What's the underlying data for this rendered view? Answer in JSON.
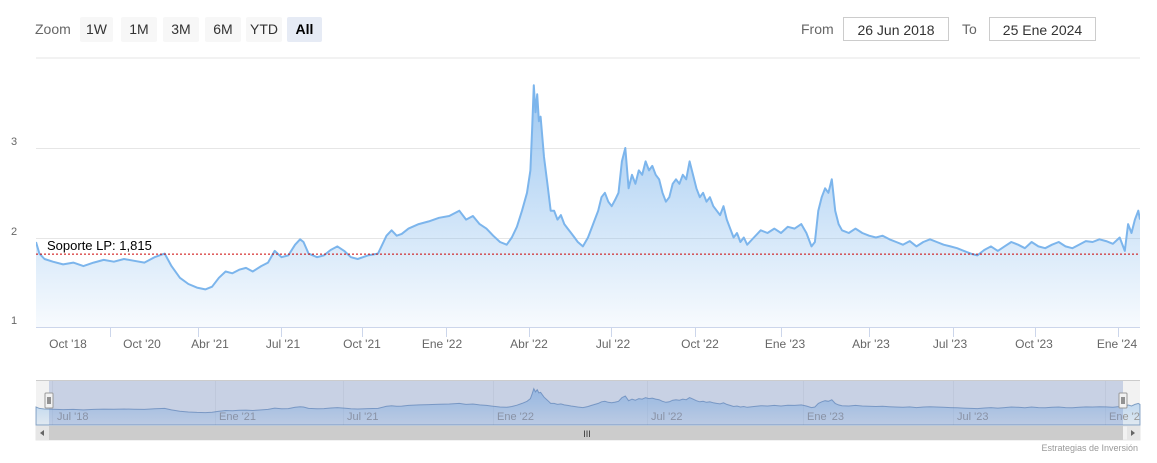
{
  "toolbar": {
    "zoom_label": "Zoom",
    "buttons": [
      "1W",
      "1M",
      "3M",
      "6M",
      "YTD",
      "All"
    ],
    "active": "All",
    "from_label": "From",
    "from_value": "26 Jun 2018",
    "to_label": "To",
    "to_value": "25 Ene 2024"
  },
  "credit": "Estrategias de Inversión",
  "navigator_labels": [
    "Jul '18",
    "Ene '21",
    "Jul '21",
    "Ene '22",
    "Jul '22",
    "Ene '23",
    "Jul '23",
    "Ene '2"
  ],
  "scrollbar_grip": "III",
  "colors": {
    "line": "#7cb5ec",
    "support": "#cc0000",
    "grid": "#e6e6e6"
  },
  "chart_data": {
    "type": "area",
    "title": "",
    "xlabel": "",
    "ylabel": "",
    "ylim": [
      1,
      3.9
    ],
    "y_ticks": [
      1,
      2,
      3
    ],
    "x_ticks": [
      "Oct '18",
      "Oct '20",
      "Abr '21",
      "Jul '21",
      "Oct '21",
      "Ene '22",
      "Abr '22",
      "Jul '22",
      "Oct '22",
      "Ene '23",
      "Abr '23",
      "Jul '23",
      "Oct '23",
      "Ene '24"
    ],
    "grid": true,
    "support_line": {
      "label": "Soporte LP: 1,815",
      "value": 1.815
    },
    "series": [
      {
        "values": [
          [
            0,
            1.95
          ],
          [
            2,
            1.82
          ],
          [
            5,
            1.76
          ],
          [
            10,
            1.73
          ],
          [
            16,
            1.7
          ],
          [
            22,
            1.72
          ],
          [
            28,
            1.68
          ],
          [
            34,
            1.72
          ],
          [
            40,
            1.75
          ],
          [
            46,
            1.73
          ],
          [
            52,
            1.76
          ],
          [
            58,
            1.74
          ],
          [
            64,
            1.72
          ],
          [
            70,
            1.78
          ],
          [
            76,
            1.82
          ],
          [
            80,
            1.68
          ],
          [
            85,
            1.55
          ],
          [
            90,
            1.48
          ],
          [
            95,
            1.44
          ],
          [
            100,
            1.42
          ],
          [
            104,
            1.45
          ],
          [
            108,
            1.55
          ],
          [
            112,
            1.62
          ],
          [
            116,
            1.6
          ],
          [
            120,
            1.64
          ],
          [
            124,
            1.66
          ],
          [
            128,
            1.62
          ],
          [
            133,
            1.68
          ],
          [
            137,
            1.72
          ],
          [
            141,
            1.85
          ],
          [
            145,
            1.78
          ],
          [
            149,
            1.8
          ],
          [
            153,
            1.92
          ],
          [
            156,
            1.98
          ],
          [
            158,
            1.95
          ],
          [
            161,
            1.82
          ],
          [
            166,
            1.78
          ],
          [
            170,
            1.8
          ],
          [
            174,
            1.86
          ],
          [
            178,
            1.9
          ],
          [
            182,
            1.85
          ],
          [
            186,
            1.78
          ],
          [
            190,
            1.76
          ],
          [
            196,
            1.8
          ],
          [
            202,
            1.82
          ],
          [
            207,
            2.02
          ],
          [
            210,
            2.08
          ],
          [
            213,
            2.02
          ],
          [
            216,
            2.04
          ],
          [
            220,
            2.1
          ],
          [
            226,
            2.15
          ],
          [
            232,
            2.18
          ],
          [
            238,
            2.22
          ],
          [
            244,
            2.24
          ],
          [
            250,
            2.3
          ],
          [
            254,
            2.2
          ],
          [
            258,
            2.24
          ],
          [
            262,
            2.15
          ],
          [
            266,
            2.1
          ],
          [
            270,
            2.02
          ],
          [
            274,
            1.95
          ],
          [
            278,
            1.92
          ],
          [
            281,
            2.0
          ],
          [
            284,
            2.12
          ],
          [
            287,
            2.3
          ],
          [
            290,
            2.5
          ],
          [
            292,
            2.75
          ],
          [
            293,
            3.2
          ],
          [
            294,
            3.7
          ],
          [
            295,
            3.4
          ],
          [
            296,
            3.6
          ],
          [
            297,
            3.3
          ],
          [
            298,
            3.35
          ],
          [
            300,
            2.9
          ],
          [
            302,
            2.6
          ],
          [
            304,
            2.3
          ],
          [
            306,
            2.3
          ],
          [
            308,
            2.2
          ],
          [
            310,
            2.25
          ],
          [
            312,
            2.15
          ],
          [
            314,
            2.1
          ],
          [
            316,
            2.05
          ],
          [
            318,
            2.0
          ],
          [
            320,
            1.95
          ],
          [
            323,
            1.9
          ],
          [
            326,
            2.0
          ],
          [
            328,
            2.1
          ],
          [
            330,
            2.2
          ],
          [
            332,
            2.3
          ],
          [
            334,
            2.45
          ],
          [
            336,
            2.5
          ],
          [
            338,
            2.4
          ],
          [
            340,
            2.35
          ],
          [
            342,
            2.42
          ],
          [
            344,
            2.5
          ],
          [
            346,
            2.85
          ],
          [
            348,
            3.0
          ],
          [
            350,
            2.55
          ],
          [
            352,
            2.7
          ],
          [
            354,
            2.6
          ],
          [
            356,
            2.75
          ],
          [
            358,
            2.7
          ],
          [
            360,
            2.85
          ],
          [
            362,
            2.75
          ],
          [
            364,
            2.8
          ],
          [
            366,
            2.7
          ],
          [
            368,
            2.65
          ],
          [
            370,
            2.5
          ],
          [
            372,
            2.4
          ],
          [
            374,
            2.45
          ],
          [
            376,
            2.6
          ],
          [
            378,
            2.65
          ],
          [
            380,
            2.6
          ],
          [
            382,
            2.7
          ],
          [
            384,
            2.65
          ],
          [
            386,
            2.85
          ],
          [
            388,
            2.7
          ],
          [
            390,
            2.55
          ],
          [
            392,
            2.45
          ],
          [
            394,
            2.5
          ],
          [
            396,
            2.4
          ],
          [
            398,
            2.45
          ],
          [
            400,
            2.35
          ],
          [
            402,
            2.3
          ],
          [
            404,
            2.25
          ],
          [
            406,
            2.35
          ],
          [
            408,
            2.2
          ],
          [
            410,
            2.1
          ],
          [
            412,
            2.0
          ],
          [
            414,
            2.05
          ],
          [
            416,
            1.95
          ],
          [
            418,
            2.0
          ],
          [
            420,
            1.92
          ],
          [
            424,
            2.0
          ],
          [
            428,
            2.08
          ],
          [
            432,
            2.05
          ],
          [
            436,
            2.1
          ],
          [
            440,
            2.05
          ],
          [
            444,
            2.12
          ],
          [
            448,
            2.1
          ],
          [
            452,
            2.15
          ],
          [
            455,
            2.05
          ],
          [
            458,
            1.9
          ],
          [
            460,
            1.95
          ],
          [
            462,
            2.3
          ],
          [
            464,
            2.45
          ],
          [
            466,
            2.55
          ],
          [
            468,
            2.5
          ],
          [
            470,
            2.65
          ],
          [
            472,
            2.3
          ],
          [
            474,
            2.15
          ],
          [
            476,
            2.08
          ],
          [
            480,
            2.05
          ],
          [
            484,
            2.1
          ],
          [
            488,
            2.05
          ],
          [
            492,
            2.02
          ],
          [
            496,
            2.0
          ],
          [
            500,
            2.02
          ],
          [
            504,
            1.98
          ],
          [
            508,
            1.95
          ],
          [
            512,
            1.92
          ],
          [
            516,
            1.96
          ],
          [
            520,
            1.9
          ],
          [
            524,
            1.95
          ],
          [
            528,
            1.98
          ],
          [
            532,
            1.95
          ],
          [
            536,
            1.92
          ],
          [
            540,
            1.9
          ],
          [
            544,
            1.88
          ],
          [
            548,
            1.85
          ],
          [
            552,
            1.82
          ],
          [
            556,
            1.8
          ],
          [
            560,
            1.86
          ],
          [
            564,
            1.9
          ],
          [
            568,
            1.85
          ],
          [
            572,
            1.9
          ],
          [
            576,
            1.95
          ],
          [
            580,
            1.92
          ],
          [
            584,
            1.88
          ],
          [
            588,
            1.95
          ],
          [
            592,
            1.9
          ],
          [
            596,
            1.88
          ],
          [
            600,
            1.92
          ],
          [
            604,
            1.95
          ],
          [
            608,
            1.9
          ],
          [
            612,
            1.88
          ],
          [
            616,
            1.92
          ],
          [
            620,
            1.96
          ],
          [
            624,
            1.95
          ],
          [
            628,
            1.98
          ],
          [
            632,
            1.96
          ],
          [
            636,
            1.93
          ],
          [
            640,
            2.0
          ],
          [
            643,
            1.85
          ],
          [
            645,
            2.15
          ],
          [
            647,
            2.05
          ],
          [
            649,
            2.2
          ],
          [
            651,
            2.3
          ],
          [
            652,
            2.2
          ]
        ]
      }
    ]
  }
}
